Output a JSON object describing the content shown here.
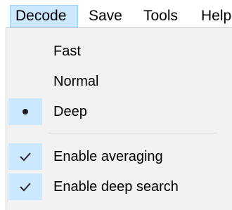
{
  "menubar": {
    "items": [
      {
        "label": "Decode",
        "active": true
      },
      {
        "label": "Save"
      },
      {
        "label": "Tools"
      },
      {
        "label": "Help"
      }
    ]
  },
  "decode_menu": {
    "items": [
      {
        "label": "Fast",
        "state": "none"
      },
      {
        "label": "Normal",
        "state": "none"
      },
      {
        "label": "Deep",
        "state": "radio-selected",
        "icon": "radio-dot-icon"
      },
      {
        "label": "Enable averaging",
        "state": "checked",
        "icon": "checkmark-icon"
      },
      {
        "label": "Enable deep search",
        "state": "checked",
        "icon": "checkmark-icon"
      }
    ]
  },
  "colors": {
    "highlight": "#cce8ff",
    "highlight_border": "#99d1ff",
    "menu_bg": "#f2f2f2"
  }
}
